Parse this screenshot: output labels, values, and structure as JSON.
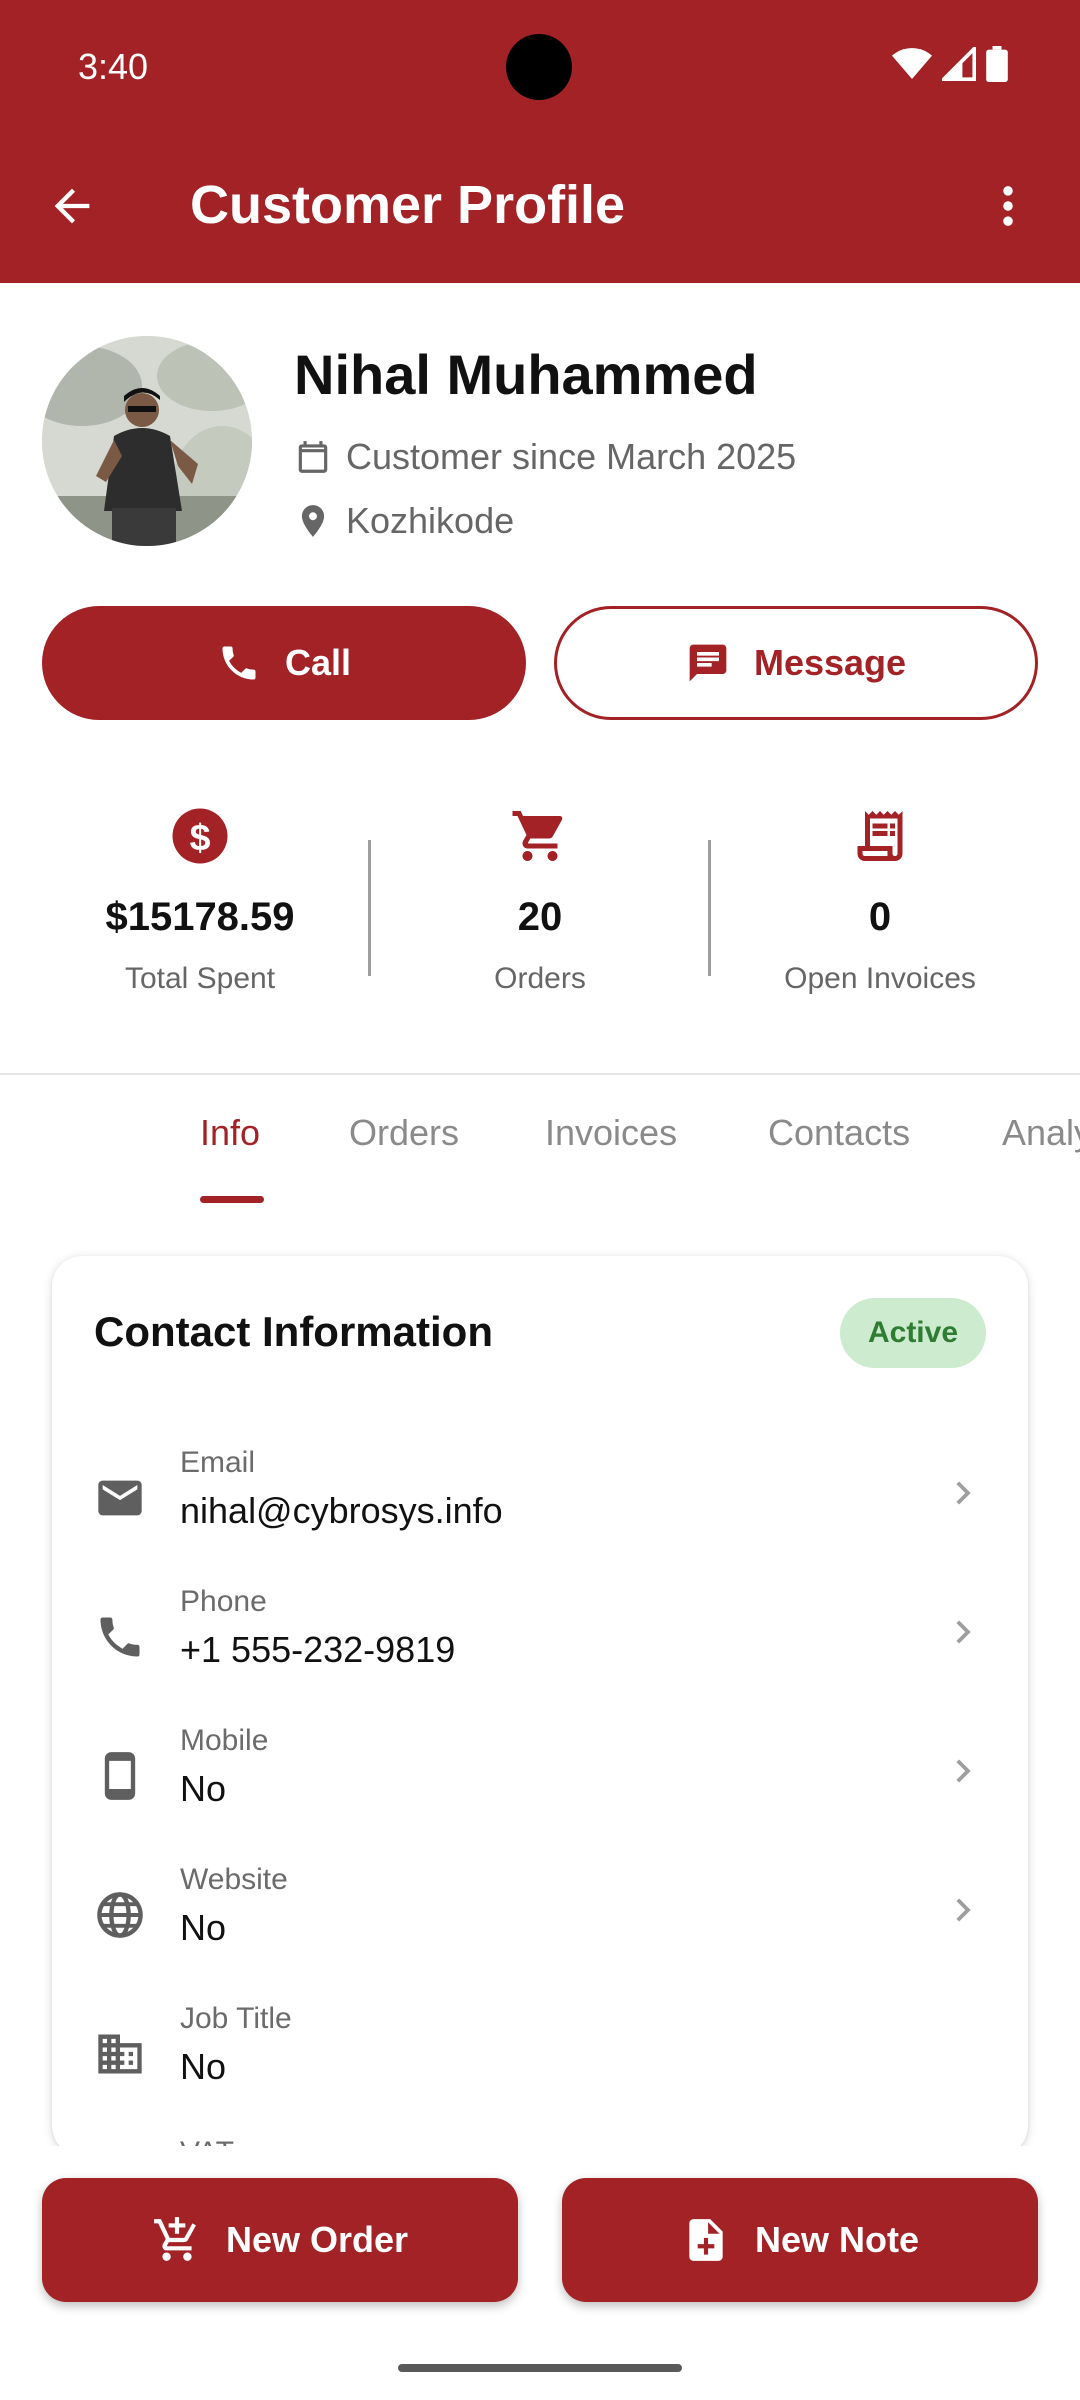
{
  "status_bar": {
    "time": "3:40"
  },
  "app_bar": {
    "title": "Customer Profile"
  },
  "profile": {
    "name": "Nihal Muhammed",
    "since": "Customer since March 2025",
    "location": "Kozhikode"
  },
  "actions": {
    "call": "Call",
    "message": "Message"
  },
  "stats": {
    "total_spent": {
      "value": "$15178.59",
      "label": "Total Spent"
    },
    "orders": {
      "value": "20",
      "label": "Orders"
    },
    "open_invoices": {
      "value": "0",
      "label": "Open Invoices"
    }
  },
  "tabs": [
    "Info",
    "Orders",
    "Invoices",
    "Contacts",
    "Analy"
  ],
  "contact_card": {
    "title": "Contact Information",
    "status": "Active",
    "rows": [
      {
        "label": "Email",
        "value": "nihal@cybrosys.info",
        "icon": "email-icon"
      },
      {
        "label": "Phone",
        "value": "+1 555-232-9819",
        "icon": "phone-icon"
      },
      {
        "label": "Mobile",
        "value": "No",
        "icon": "mobile-icon"
      },
      {
        "label": "Website",
        "value": "No",
        "icon": "globe-icon"
      },
      {
        "label": "Job Title",
        "value": "No",
        "icon": "building-icon"
      }
    ],
    "partial_label": "VAT"
  },
  "bottom_actions": {
    "new_order": "New Order",
    "new_note": "New Note"
  },
  "colors": {
    "primary": "#A32226",
    "badge_bg": "#CDEBCF",
    "badge_text": "#2E7D32"
  }
}
